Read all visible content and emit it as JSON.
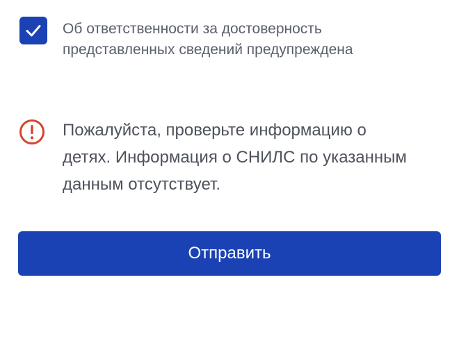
{
  "colors": {
    "accent": "#1b42b4",
    "warning": "#d4452c",
    "text": "#4d525c"
  },
  "consent": {
    "checked": true,
    "icon": "check-icon",
    "line1": "Об ответственности за достоверность",
    "line2": "представленных сведений предупреждена"
  },
  "warning": {
    "icon": "exclamation-circle-icon",
    "line1": "Пожалуйста, проверьте информацию о",
    "line2": "детях. Информация о СНИЛС по указанным",
    "line3": "данным отсутствует."
  },
  "submit": {
    "label": "Отправить"
  }
}
